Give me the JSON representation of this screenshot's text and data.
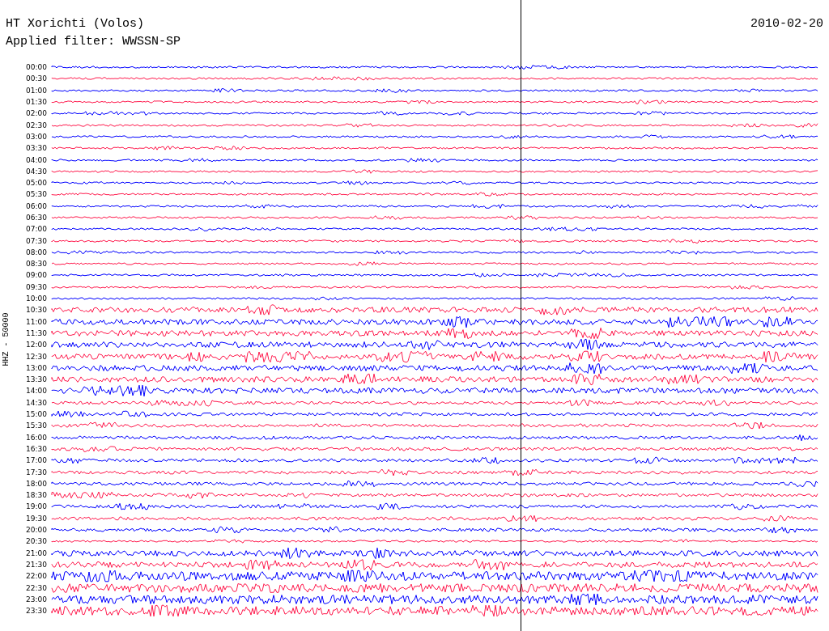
{
  "header": {
    "station": "HT Xorichti (Volos)",
    "date": "2010-02-20",
    "filter": "Applied filter: WWSSN-SP"
  },
  "axis_label": "HHZ - 50000",
  "rows": [
    {
      "time": "00:00",
      "color": "#0000ff"
    },
    {
      "time": "00:30",
      "color": "#ff1a4d"
    },
    {
      "time": "01:00",
      "color": "#0000ff"
    },
    {
      "time": "01:30",
      "color": "#ff1a4d"
    },
    {
      "time": "02:00",
      "color": "#0000ff"
    },
    {
      "time": "02:30",
      "color": "#ff1a4d"
    },
    {
      "time": "03:00",
      "color": "#0000ff"
    },
    {
      "time": "03:30",
      "color": "#ff1a4d"
    },
    {
      "time": "04:00",
      "color": "#0000ff"
    },
    {
      "time": "04:30",
      "color": "#ff1a4d"
    },
    {
      "time": "05:00",
      "color": "#0000ff"
    },
    {
      "time": "05:30",
      "color": "#ff1a4d"
    },
    {
      "time": "06:00",
      "color": "#0000ff"
    },
    {
      "time": "06:30",
      "color": "#ff1a4d"
    },
    {
      "time": "07:00",
      "color": "#0000ff"
    },
    {
      "time": "07:30",
      "color": "#ff1a4d"
    },
    {
      "time": "08:00",
      "color": "#0000ff"
    },
    {
      "time": "08:30",
      "color": "#ff1a4d"
    },
    {
      "time": "09:00",
      "color": "#0000ff"
    },
    {
      "time": "09:30",
      "color": "#ff1a4d"
    },
    {
      "time": "10:00",
      "color": "#0000ff"
    },
    {
      "time": "10:30",
      "color": "#ff1a4d"
    },
    {
      "time": "11:00",
      "color": "#0000ff"
    },
    {
      "time": "11:30",
      "color": "#ff1a4d"
    },
    {
      "time": "12:00",
      "color": "#0000ff"
    },
    {
      "time": "12:30",
      "color": "#ff1a4d"
    },
    {
      "time": "13:00",
      "color": "#0000ff"
    },
    {
      "time": "13:30",
      "color": "#ff1a4d"
    },
    {
      "time": "14:00",
      "color": "#0000ff"
    },
    {
      "time": "14:30",
      "color": "#ff1a4d"
    },
    {
      "time": "15:00",
      "color": "#0000ff"
    },
    {
      "time": "15:30",
      "color": "#ff1a4d"
    },
    {
      "time": "16:00",
      "color": "#0000ff"
    },
    {
      "time": "16:30",
      "color": "#ff1a4d"
    },
    {
      "time": "17:00",
      "color": "#0000ff"
    },
    {
      "time": "17:30",
      "color": "#ff1a4d"
    },
    {
      "time": "18:00",
      "color": "#0000ff"
    },
    {
      "time": "18:30",
      "color": "#ff1a4d"
    },
    {
      "time": "19:00",
      "color": "#0000ff"
    },
    {
      "time": "19:30",
      "color": "#ff1a4d"
    },
    {
      "time": "20:00",
      "color": "#0000ff"
    },
    {
      "time": "20:30",
      "color": "#ff1a4d"
    },
    {
      "time": "21:00",
      "color": "#0000ff"
    },
    {
      "time": "21:30",
      "color": "#ff1a4d"
    },
    {
      "time": "22:00",
      "color": "#0000ff"
    },
    {
      "time": "22:30",
      "color": "#ff1a4d"
    },
    {
      "time": "23:00",
      "color": "#0000ff"
    },
    {
      "time": "23:30",
      "color": "#ff1a4d"
    }
  ]
}
